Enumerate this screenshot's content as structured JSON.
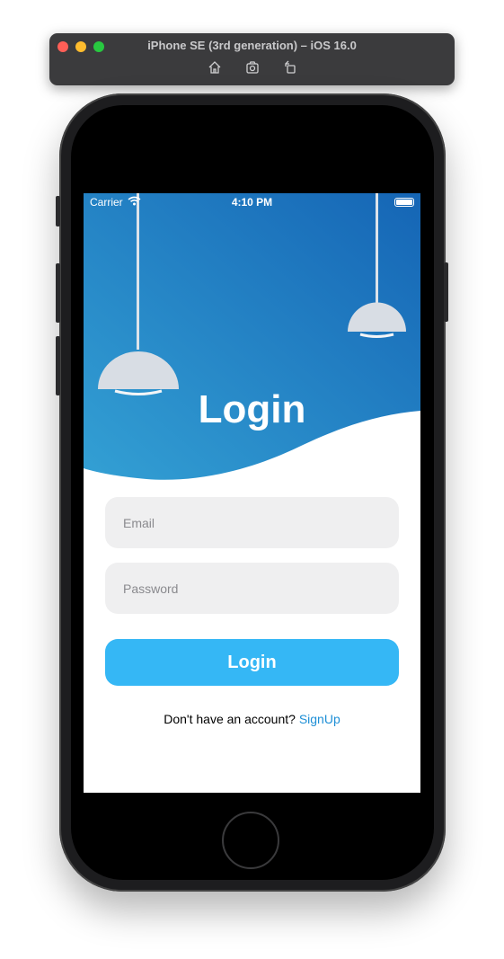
{
  "simulator": {
    "title": "iPhone SE (3rd generation) – iOS 16.0",
    "tools": [
      "home-icon",
      "screenshot-icon",
      "rotate-icon"
    ]
  },
  "status_bar": {
    "carrier": "Carrier",
    "time": "4:10 PM"
  },
  "header": {
    "title": "Login",
    "gradient": [
      "#33a0d4",
      "#1565b5"
    ]
  },
  "form": {
    "email_placeholder": "Email",
    "password_placeholder": "Password",
    "submit_label": "Login"
  },
  "footer": {
    "prompt": "Don't have an account? ",
    "signup_label": "SignUp"
  },
  "colors": {
    "button": "#35b7f5",
    "link": "#1e8fd6",
    "input_bg": "#efeff0"
  }
}
